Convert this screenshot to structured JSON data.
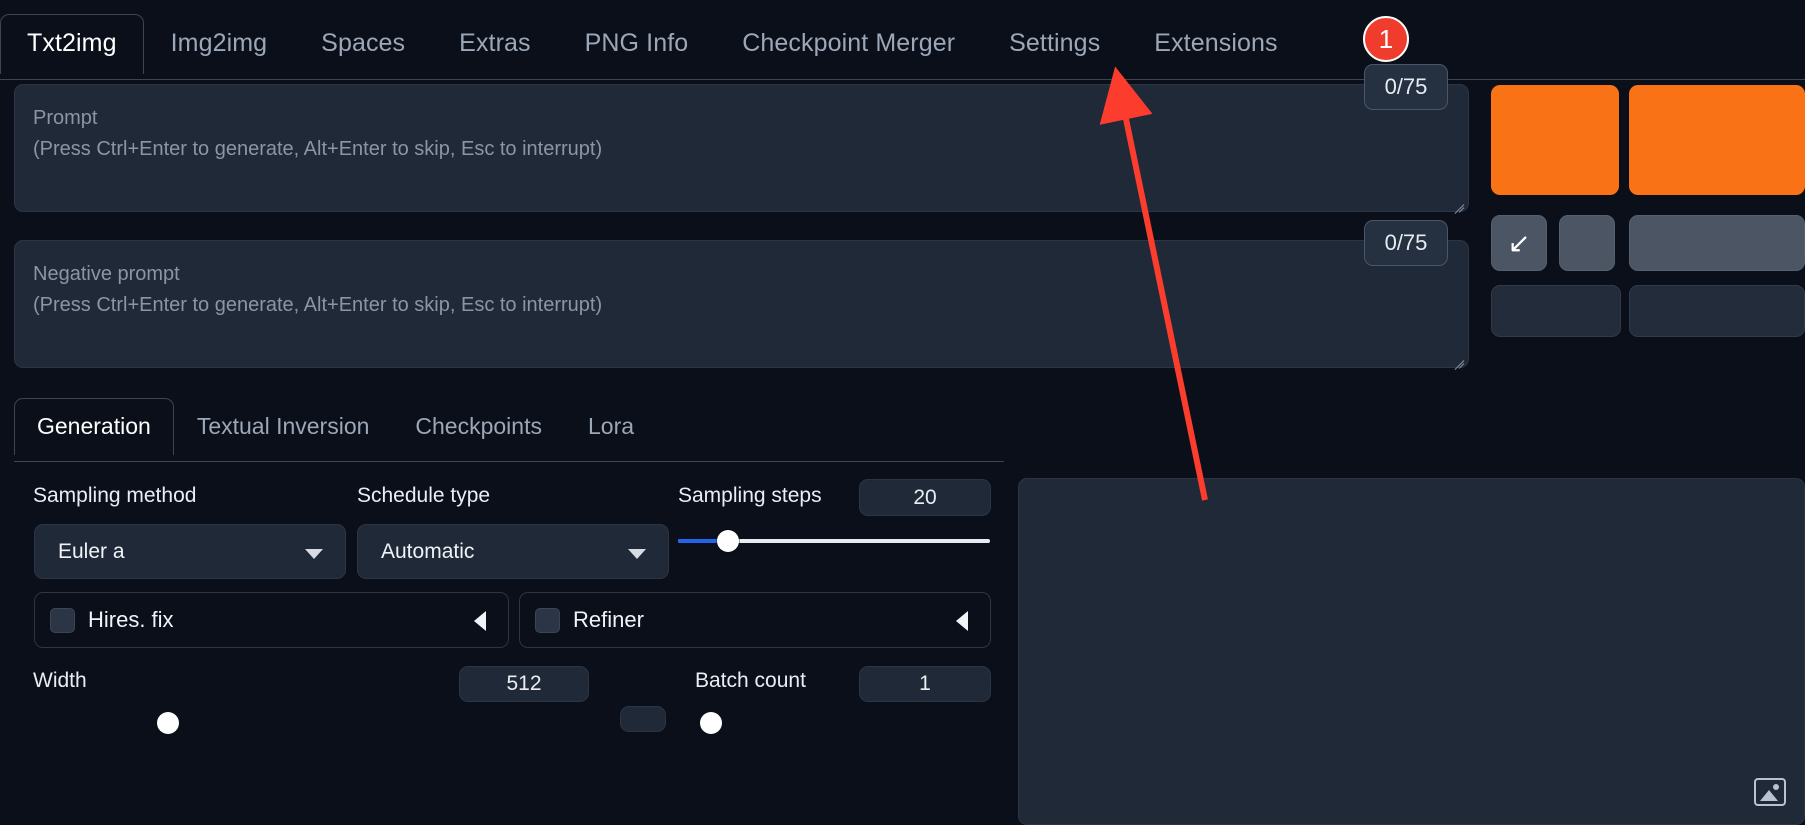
{
  "app": {
    "title": "Stable Diffusion WebUI",
    "accent_orange": "#f97316",
    "accent_blue": "#2563eb",
    "annotation_red": "#ef3c2d",
    "background": "#0b0f19",
    "panel": "#1f2937"
  },
  "topbar": {
    "tabs": [
      {
        "label": "Txt2img",
        "active": true
      },
      {
        "label": "Img2img",
        "active": false
      },
      {
        "label": "Spaces",
        "active": false
      },
      {
        "label": "Extras",
        "active": false
      },
      {
        "label": "PNG Info",
        "active": false
      },
      {
        "label": "Checkpoint Merger",
        "active": false
      },
      {
        "label": "Settings",
        "active": false
      },
      {
        "label": "Extensions",
        "active": false
      }
    ]
  },
  "prompt": {
    "positive": {
      "value": "",
      "placeholder_line1": "Prompt",
      "placeholder_line2": "(Press Ctrl+Enter to generate, Alt+Enter to skip, Esc to interrupt)",
      "token_counter": "0/75"
    },
    "negative": {
      "value": "",
      "placeholder_line1": "Negative prompt",
      "placeholder_line2": "(Press Ctrl+Enter to generate, Alt+Enter to skip, Esc to interrupt)",
      "token_counter": "0/75"
    }
  },
  "actions": {
    "generate_label": "",
    "send_arrow_icon": "arrow-down-left-icon",
    "send_arrow_glyph": "↙"
  },
  "subtabs": {
    "tabs": [
      {
        "label": "Generation",
        "active": true
      },
      {
        "label": "Textual Inversion",
        "active": false
      },
      {
        "label": "Checkpoints",
        "active": false
      },
      {
        "label": "Lora",
        "active": false
      }
    ]
  },
  "generation": {
    "sampling_method": {
      "label": "Sampling method",
      "value": "Euler a"
    },
    "schedule_type": {
      "label": "Schedule type",
      "value": "Automatic"
    },
    "sampling_steps": {
      "label": "Sampling steps",
      "value": "20",
      "min": 1,
      "max": 150,
      "percent": 16
    },
    "hires_fix": {
      "label": "Hires. fix",
      "checked": false
    },
    "refiner": {
      "label": "Refiner",
      "checked": false
    },
    "width": {
      "label": "Width",
      "value": "512"
    },
    "batch_count": {
      "label": "Batch count",
      "value": "1"
    }
  },
  "preview": {
    "placeholder_icon": "image-placeholder-icon"
  },
  "annotation": {
    "badge_number": "1",
    "target": "prompt-area"
  }
}
